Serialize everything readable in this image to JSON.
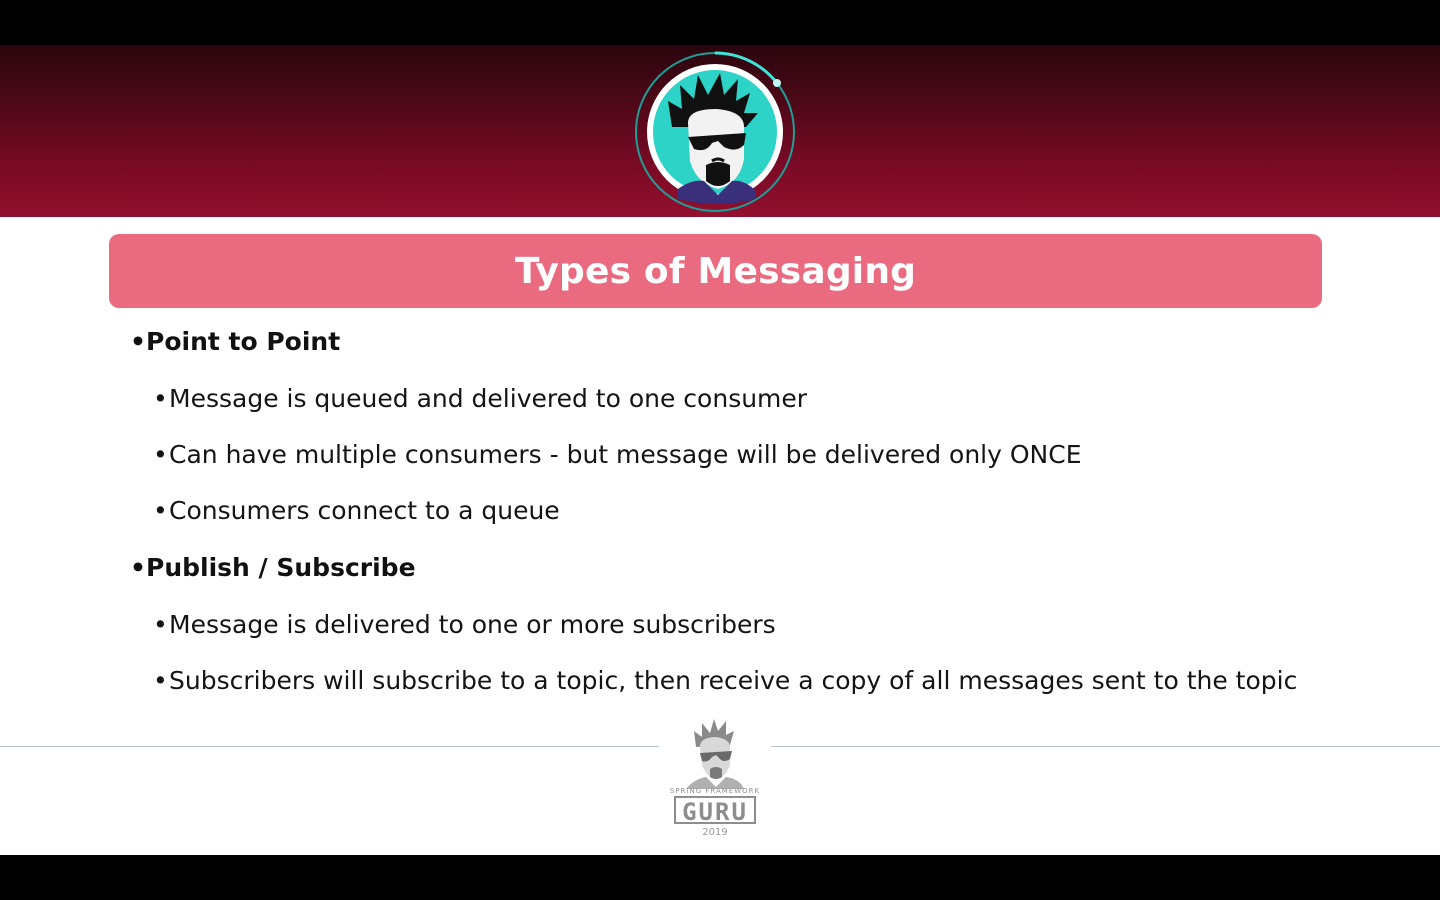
{
  "slide": {
    "title": "Types of Messaging",
    "sections": [
      {
        "heading": "Point to Point",
        "items": [
          "Message is queued and delivered to one consumer",
          "Can have multiple consumers - but message will be delivered only ONCE",
          "Consumers connect to a queue"
        ]
      },
      {
        "heading": "Publish / Subscribe",
        "items": [
          "Message is delivered to one or more subscribers",
          "Subscribers will subscribe to a topic, then receive a copy of all messages sent to the topic"
        ]
      }
    ],
    "bullet": "•"
  },
  "footer": {
    "tagline": "SPRING FRAMEWORK",
    "brand": "GURU",
    "year": "2019"
  },
  "colors": {
    "header_dark": "#2a060d",
    "header_light": "#93102e",
    "title_bar": "#ea6b80",
    "avatar_ring": "#2ed3c8"
  },
  "icons": {
    "avatar": "guru-avatar-icon",
    "footer_logo": "spring-framework-guru-logo"
  }
}
